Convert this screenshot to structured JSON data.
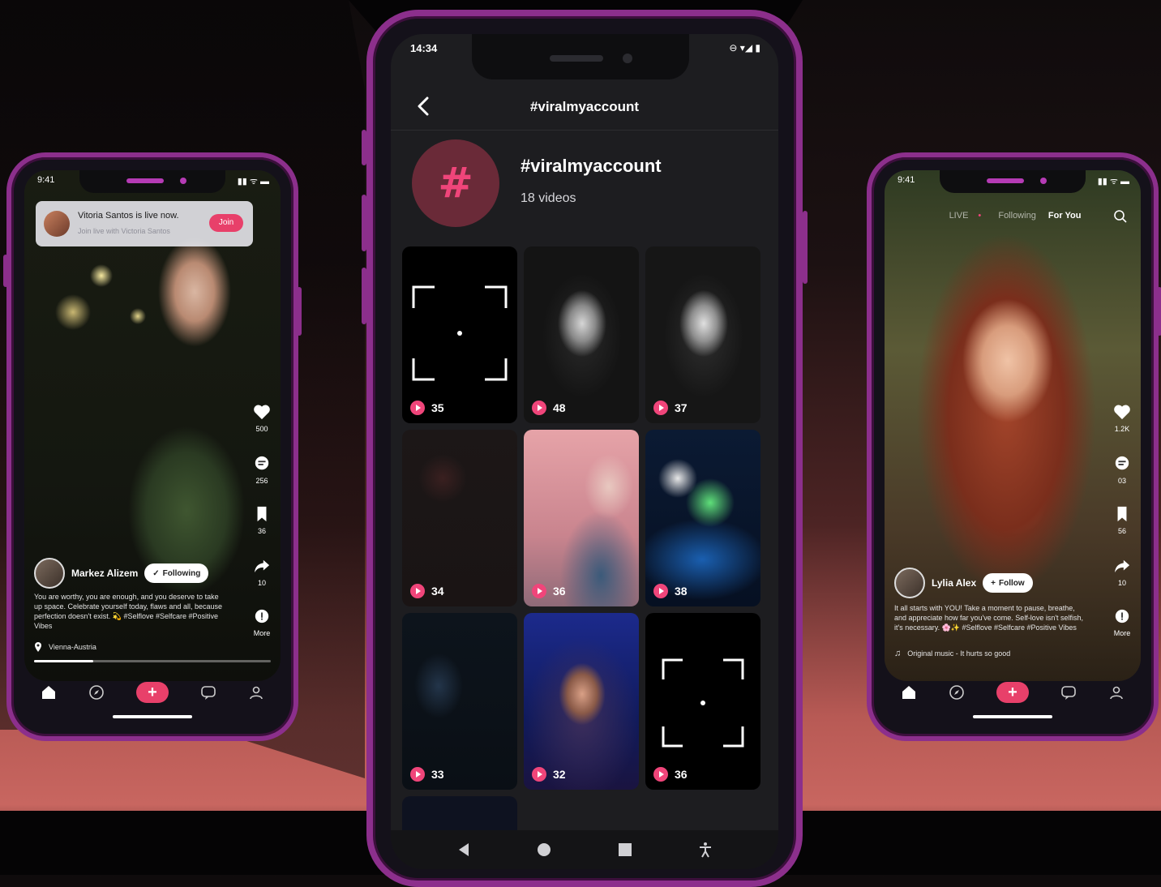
{
  "left_phone": {
    "time": "9:41",
    "notification": {
      "title": "Vitoria Santos is live now.",
      "subtitle": "Join live with Victoria Santos",
      "join_label": "Join"
    },
    "rail": {
      "likes": "500",
      "comments": "256",
      "saves": "36",
      "shares": "10",
      "more": "More"
    },
    "user": {
      "name": "Markez Alizem",
      "follow_label": "Following"
    },
    "caption": "You are worthy, you are enough, and you deserve to take up space. Celebrate yourself today, flaws and all, because perfection doesn't exist. 💫 #Selflove #Selfcare #Positive Vibes",
    "location": "Vienna-Austria",
    "progress": 0.25
  },
  "center_phone": {
    "time": "14:34",
    "header_title": "#viralmyaccount",
    "hashtag_symbol": "#",
    "hashtag_name": "#viralmyaccount",
    "video_count": "18 videos",
    "tiles": [
      {
        "count": "35",
        "kind": "placeholder"
      },
      {
        "count": "48",
        "kind": "bw-portrait"
      },
      {
        "count": "37",
        "kind": "bw-portrait"
      },
      {
        "count": "34",
        "kind": "dark"
      },
      {
        "count": "36",
        "kind": "pink-singer"
      },
      {
        "count": "38",
        "kind": "concert"
      },
      {
        "count": "33",
        "kind": "night"
      },
      {
        "count": "32",
        "kind": "blue-singer"
      },
      {
        "count": "36",
        "kind": "placeholder"
      }
    ],
    "accent": "#f0457a"
  },
  "right_phone": {
    "time": "9:41",
    "tabs": {
      "live": "LIVE",
      "following": "Following",
      "for_you": "For You"
    },
    "rail": {
      "likes": "1.2K",
      "comments": "03",
      "saves": "56",
      "shares": "10",
      "more": "More"
    },
    "user": {
      "name": "Lylia Alex",
      "follow_label": "Follow"
    },
    "caption": "It all starts with YOU! Take a moment to pause, breathe, and appreciate how far you've come. Self-love isn't selfish, it's necessary. 🌸✨ #Selflove #Selfcare #Positive Vibes",
    "music": "Original music - It hurts so good"
  },
  "colors": {
    "frame": "#8c2f8c",
    "accent": "#e8406a"
  }
}
